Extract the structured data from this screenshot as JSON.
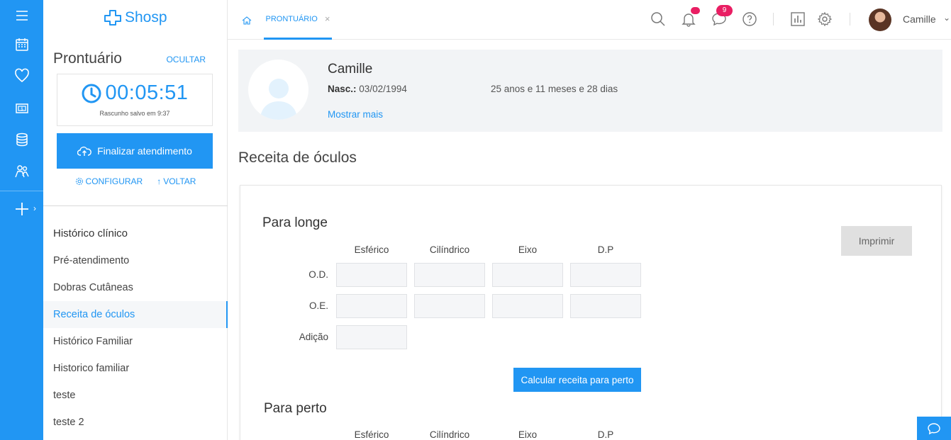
{
  "brand": {
    "logo_text": "Shosp",
    "color": "#2196f3"
  },
  "rail": {
    "icons": [
      "menu-icon",
      "calendar-icon",
      "heart-icon",
      "money-icon",
      "database-icon",
      "users-icon",
      "plus-icon"
    ]
  },
  "sidebar": {
    "title": "Prontuário",
    "hide_label": "OCULTAR",
    "timer": {
      "value": "00:05:51",
      "note": "Rascunho salvo em 9:37"
    },
    "finish_button": "Finalizar atendimento",
    "configure_label": "CONFIGURAR",
    "back_label": "VOLTAR",
    "history_title": "Histórico clínico",
    "items": [
      {
        "label": "Pré-atendimento",
        "active": false
      },
      {
        "label": "Dobras Cutâneas",
        "active": false
      },
      {
        "label": "Receita de óculos",
        "active": true
      },
      {
        "label": "Histórico Familiar",
        "active": false
      },
      {
        "label": "Historico familiar",
        "active": false
      },
      {
        "label": "teste",
        "active": false
      },
      {
        "label": "teste 2",
        "active": false
      }
    ]
  },
  "topbar": {
    "tab_label": "PRONTUÁRIO",
    "tab_close": "×",
    "messages_count": "9",
    "user_name": "Camille"
  },
  "patient": {
    "name": "Camille",
    "birth_label": "Nasc.:",
    "birth_date": "03/02/1994",
    "age": "25 anos e 11 meses e 28 dias",
    "show_more": "Mostrar mais"
  },
  "prescription": {
    "section_title": "Receita de óculos",
    "far_title": "Para longe",
    "near_title": "Para perto",
    "columns": [
      "Esférico",
      "Cilíndrico",
      "Eixo",
      "D.P"
    ],
    "rows": [
      "O.D.",
      "O.E."
    ],
    "addition_label": "Adição",
    "print_button": "Imprimir",
    "calc_button": "Calcular receita para perto"
  }
}
